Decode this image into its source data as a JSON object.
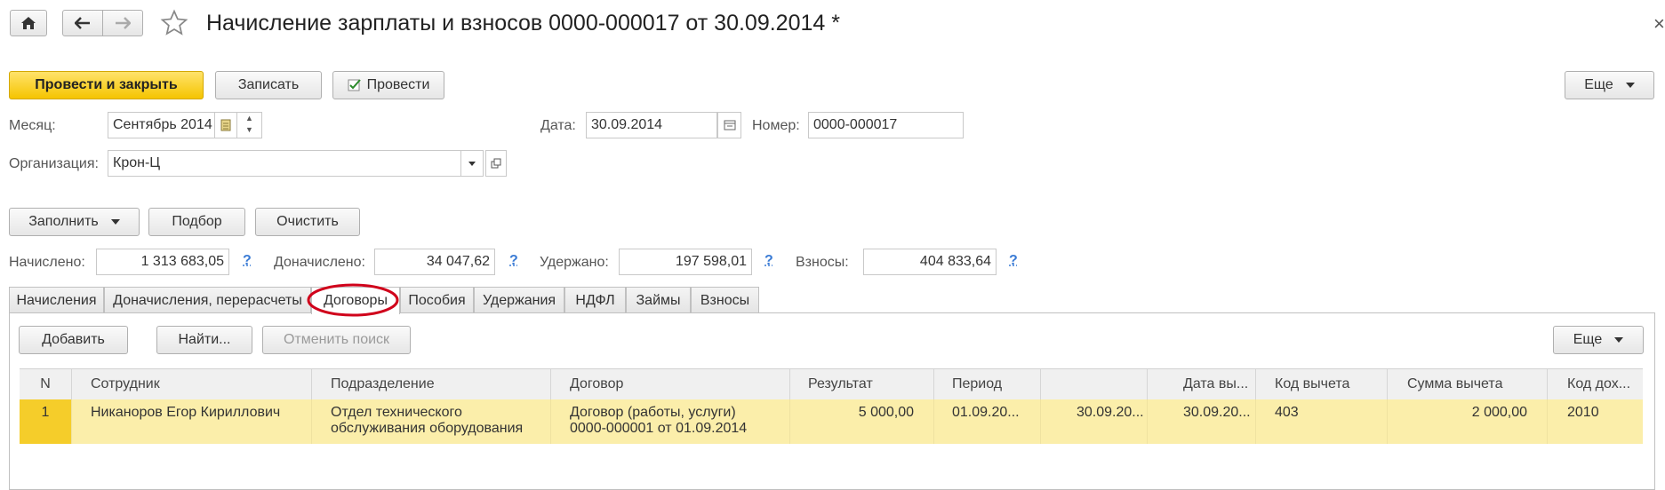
{
  "window": {
    "title": "Начисление зарплаты и взносов 0000-000017 от 30.09.2014 *",
    "close_glyph": "×"
  },
  "toolbar": {
    "post_close": "Провести и закрыть",
    "save": "Записать",
    "post": "Провести",
    "more": "Еще"
  },
  "form": {
    "month_label": "Месяц:",
    "month_value": "Сентябрь 2014",
    "date_label": "Дата:",
    "date_value": "30.09.2014",
    "number_label": "Номер:",
    "number_value": "0000-000017",
    "org_label": "Организация:",
    "org_value": "Крон-Ц"
  },
  "actions": {
    "fill": "Заполнить",
    "pick": "Подбор",
    "clear": "Очистить"
  },
  "totals": {
    "accrued_label": "Начислено:",
    "accrued_value": "1 313 683,05",
    "extra_label": "Доначислено:",
    "extra_value": "34 047,62",
    "withheld_label": "Удержано:",
    "withheld_value": "197 598,01",
    "contrib_label": "Взносы:",
    "contrib_value": "404 833,64",
    "help_glyph": "?"
  },
  "tabs": [
    "Начисления",
    "Доначисления, перерасчеты",
    "Договоры",
    "Пособия",
    "Удержания",
    "НДФЛ",
    "Займы",
    "Взносы"
  ],
  "active_tab": "Договоры",
  "table_toolbar": {
    "add": "Добавить",
    "find": "Найти...",
    "cancel_search": "Отменить поиск",
    "more": "Еще"
  },
  "table": {
    "columns": [
      "N",
      "Сотрудник",
      "Подразделение",
      "Договор",
      "Результат",
      "Период",
      "",
      "Дата вы...",
      "Код вычета",
      "Сумма вычета",
      "Код дох..."
    ],
    "rows": [
      {
        "n": "1",
        "employee": "Никаноров Егор Кириллович",
        "department_1": "Отдел технического",
        "department_2": "обслуживания оборудования",
        "contract_1": "Договор (работы, услуги)",
        "contract_2": "0000-000001 от 01.09.2014",
        "result": "5 000,00",
        "period_start": "01.09.20...",
        "period_end": "30.09.20...",
        "pay_date": "30.09.20...",
        "deduction_code": "403",
        "deduction_sum": "2 000,00",
        "income_code": "2010"
      }
    ]
  },
  "colors": {
    "primary": "#f5c400",
    "row_highlight": "#fbeeaa",
    "highlight_circle": "#d0021b"
  }
}
